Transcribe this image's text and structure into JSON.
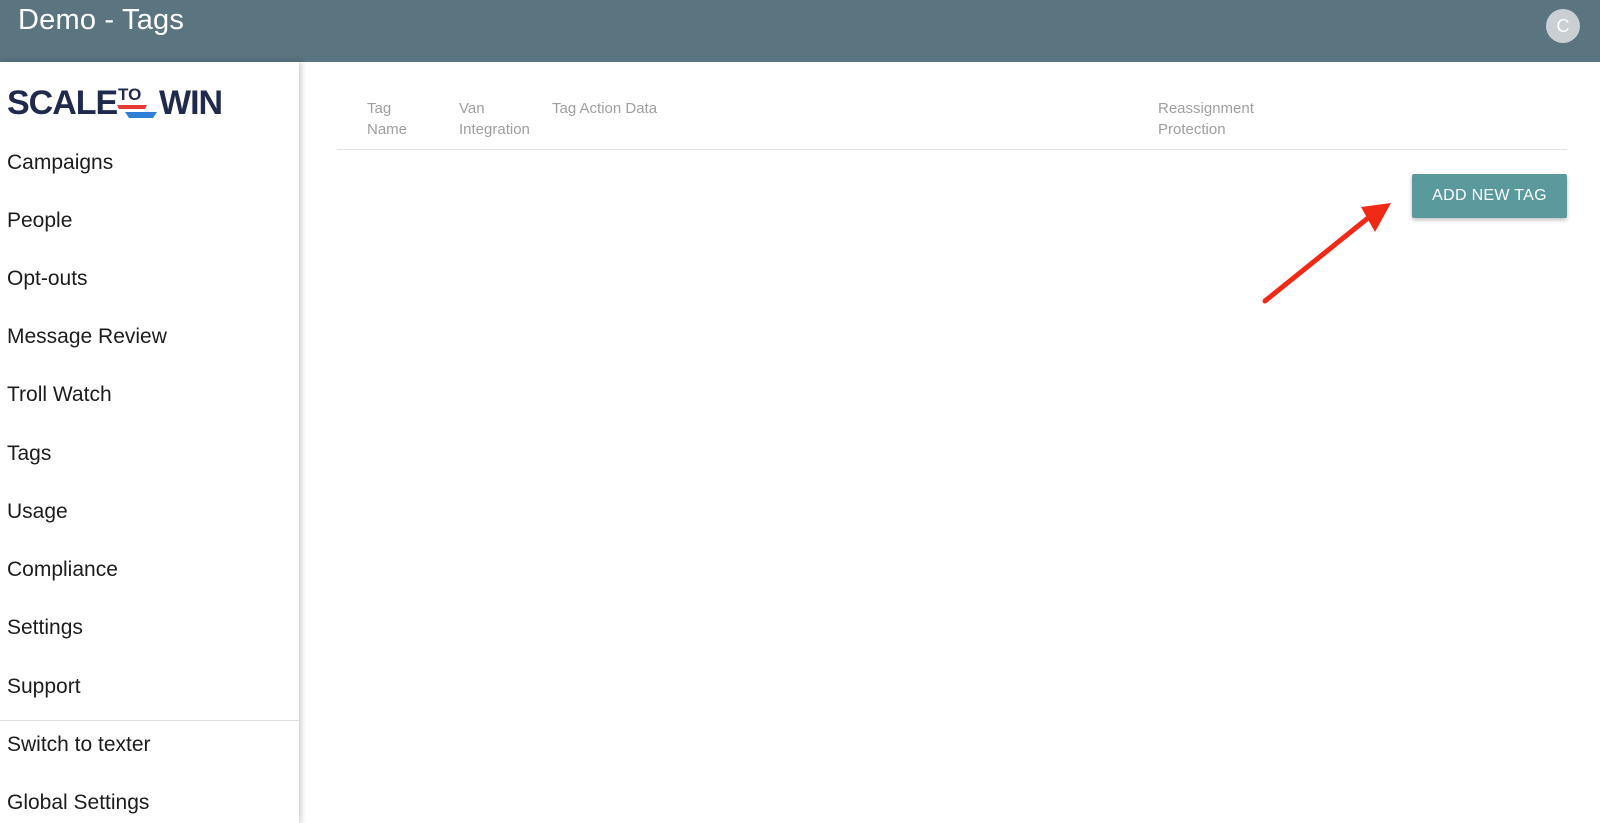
{
  "header": {
    "title": "Demo - Tags",
    "avatar_initial": "C"
  },
  "brand": {
    "logo_text_left": "SCALE",
    "logo_text_mid": "TO",
    "logo_text_right": "WIN",
    "colors": {
      "navy": "#1f2a4d",
      "red": "#e53935",
      "blue": "#2f7fd6"
    }
  },
  "sidebar": {
    "items": [
      {
        "label": "Campaigns"
      },
      {
        "label": "People"
      },
      {
        "label": "Opt-outs"
      },
      {
        "label": "Message Review"
      },
      {
        "label": "Troll Watch"
      },
      {
        "label": "Tags"
      },
      {
        "label": "Usage"
      },
      {
        "label": "Compliance"
      },
      {
        "label": "Settings"
      },
      {
        "label": "Support"
      }
    ],
    "secondary": [
      {
        "label": "Switch to texter"
      },
      {
        "label": "Global Settings"
      }
    ]
  },
  "table": {
    "columns": [
      {
        "line1": "Tag",
        "line2": "Name"
      },
      {
        "line1": "Van",
        "line2": "Integration"
      },
      {
        "line1": "Tag Action Data",
        "line2": ""
      },
      {
        "line1": "Reassignment",
        "line2": "Protection"
      }
    ]
  },
  "actions": {
    "add_tag_label": "ADD NEW TAG"
  },
  "colors": {
    "topbar": "#5a7480",
    "button": "#5a9a9d",
    "annotation_arrow": "#f02a17"
  }
}
